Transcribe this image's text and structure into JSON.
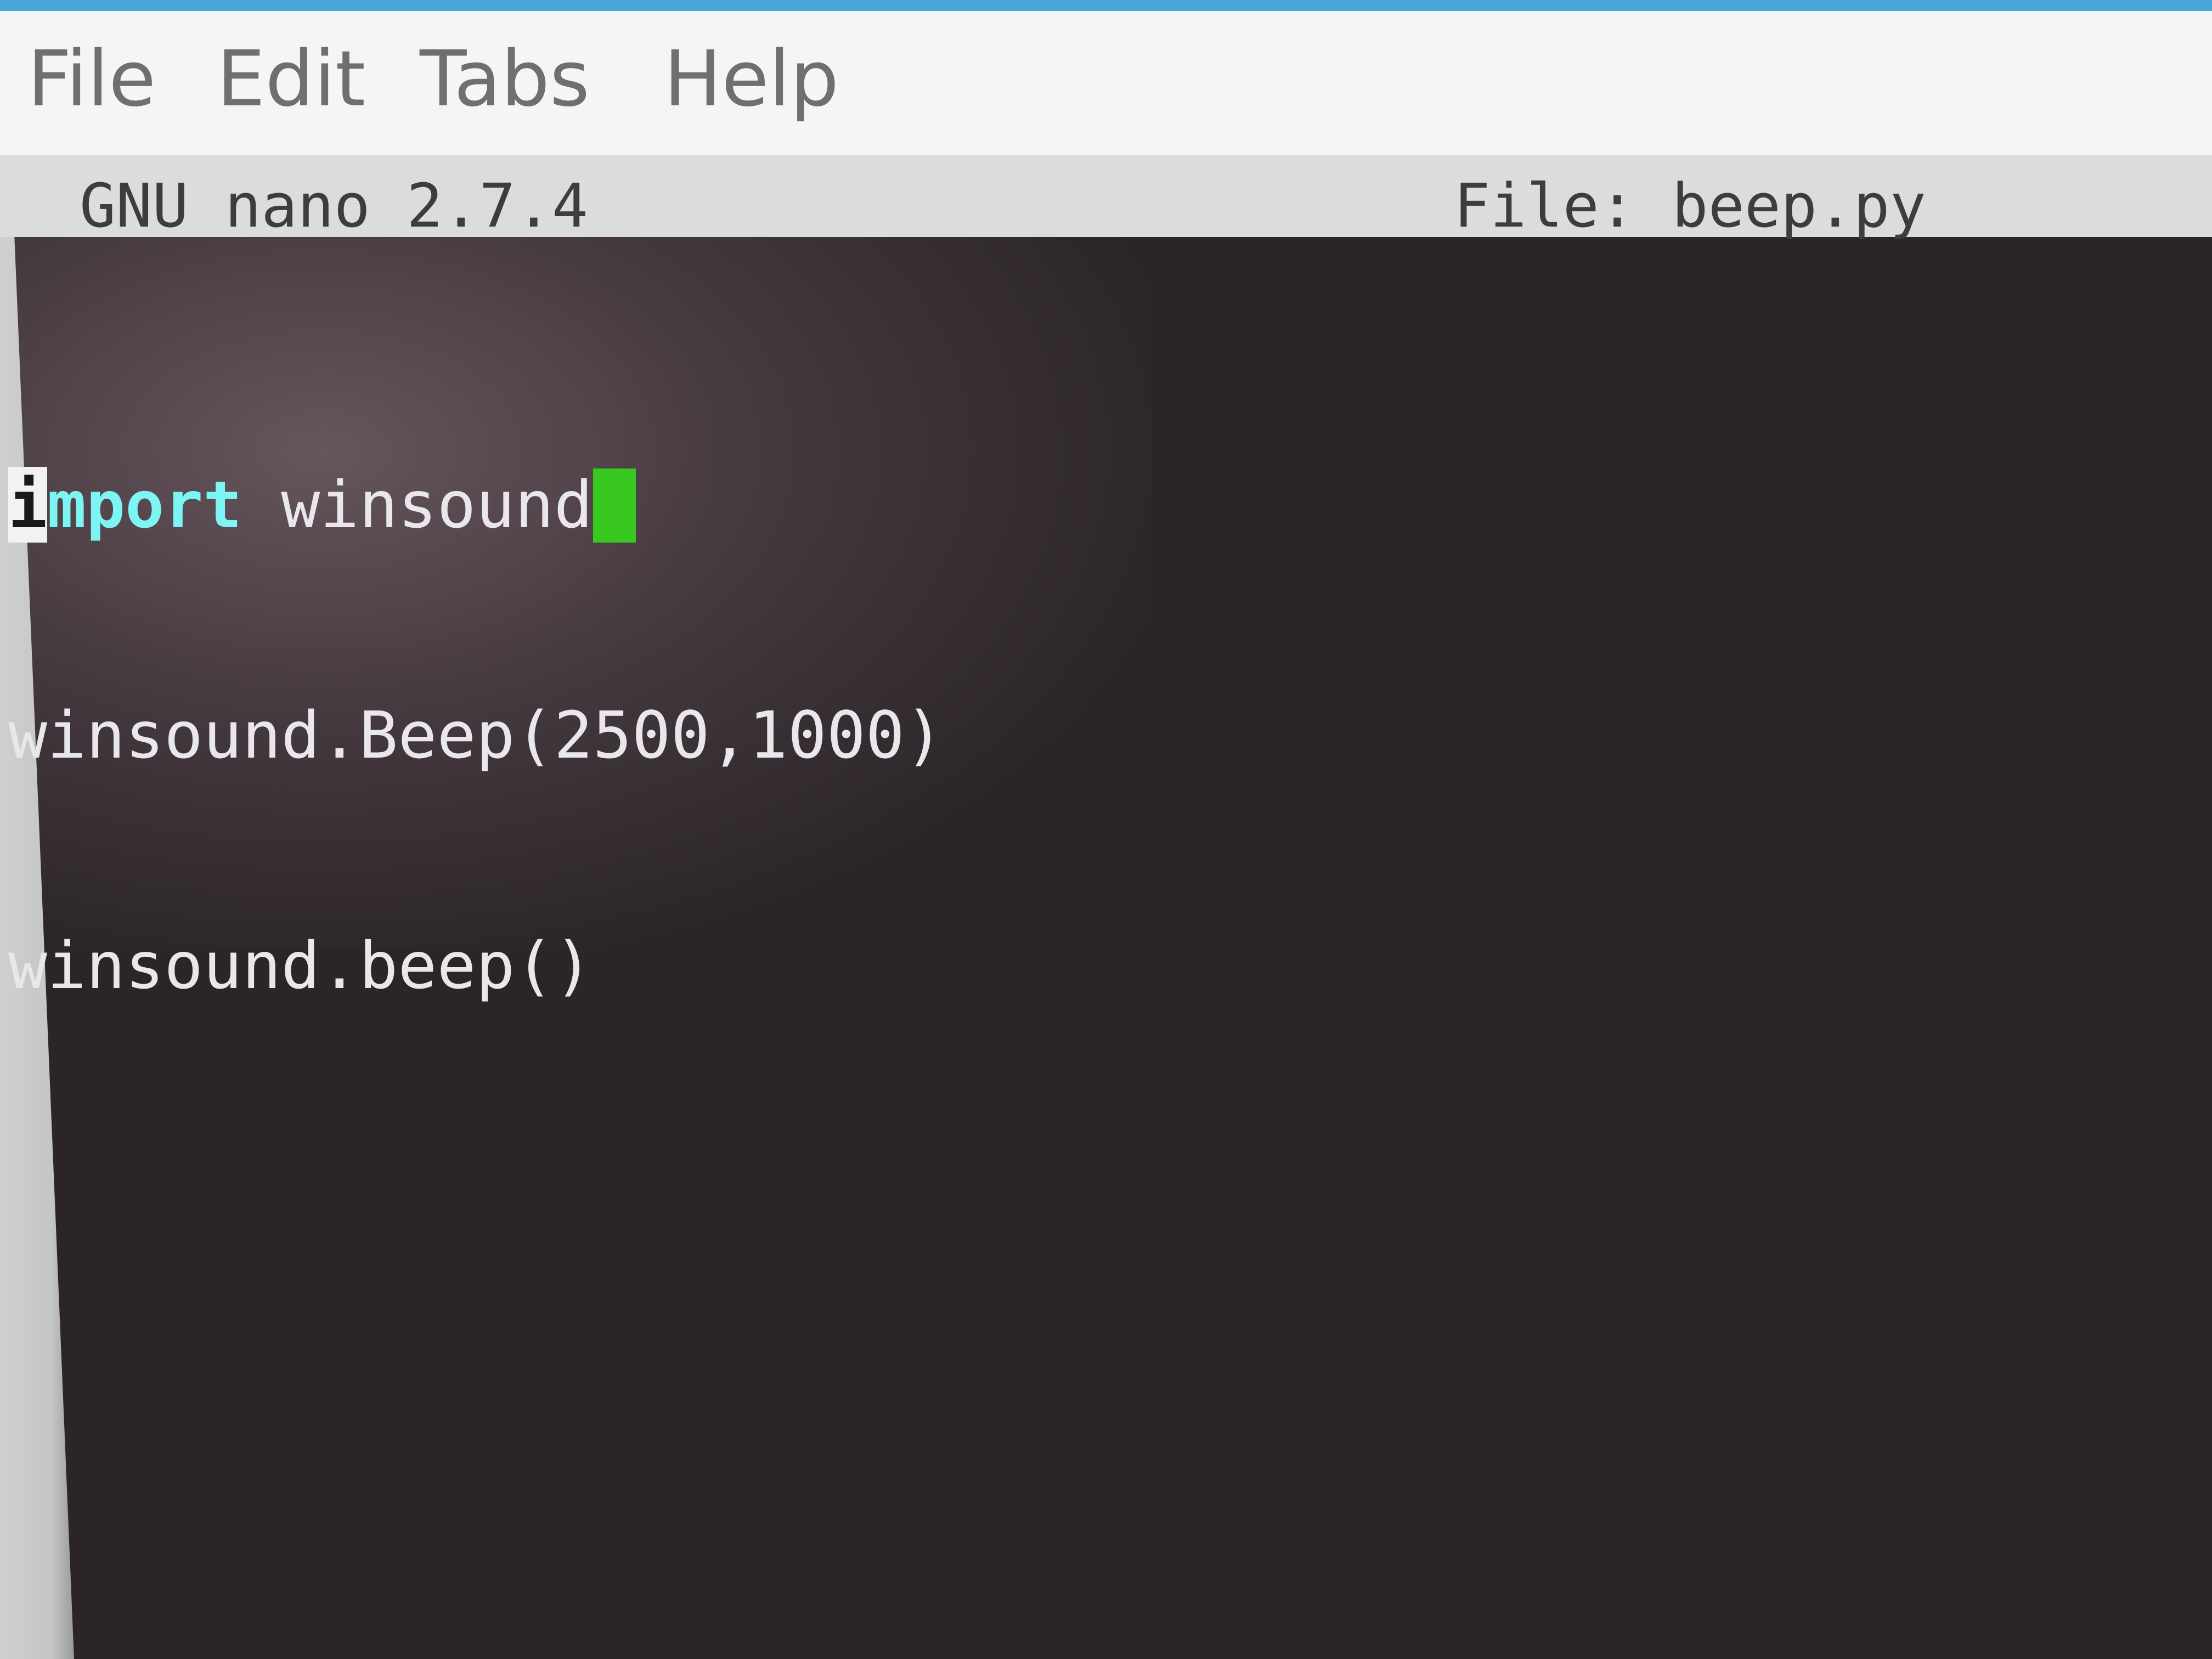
{
  "menubar": {
    "items": [
      "File",
      "Edit",
      "Tabs",
      "Help"
    ]
  },
  "nano": {
    "version_label": "GNU nano 2.7.4",
    "file_label": "File: beep.py"
  },
  "editor": {
    "lines": [
      {
        "keyword": "import",
        "rest": " winsound"
      },
      {
        "text": "winsound.Beep(2500,1000)"
      },
      {
        "text": "winsound.beep()"
      }
    ],
    "keyword_highlight_char": "i",
    "keyword_remainder": "mport"
  },
  "colors": {
    "menubar_bg": "#f4f6f6",
    "titlebar_bg": "#dcdcdc",
    "terminal_bg": "#2b2528",
    "keyword": "#7ef5f5",
    "cursor": "#38c81f",
    "text": "#e9e6ec"
  }
}
